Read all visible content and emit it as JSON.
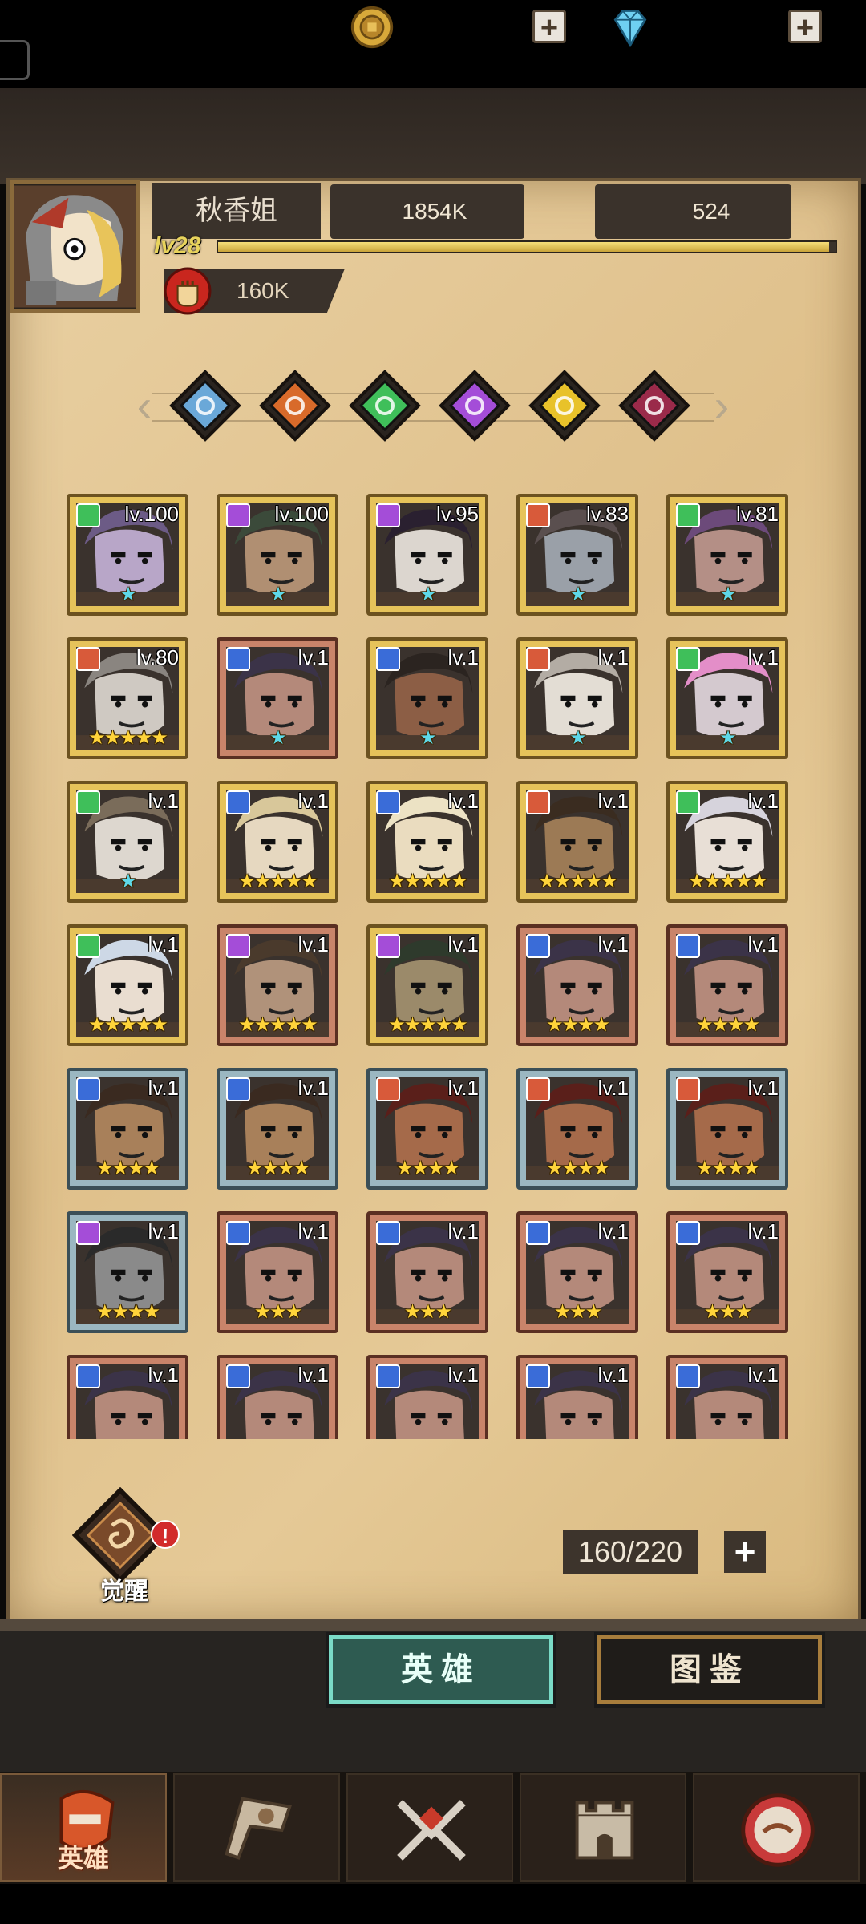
{
  "player": {
    "name": "秋香姐",
    "level": "lv28",
    "xp_fraction": 0.99,
    "power": "160K"
  },
  "resources": {
    "gold": "1854K",
    "gems": "524",
    "plus": "+"
  },
  "filters": [
    {
      "name": "all-class-filter",
      "color": "#6aa8d8"
    },
    {
      "name": "fire-class-filter",
      "color": "#d86a2a"
    },
    {
      "name": "nature-class-filter",
      "color": "#3fbf5a"
    },
    {
      "name": "arcane-class-filter",
      "color": "#a44dd8"
    },
    {
      "name": "light-class-filter",
      "color": "#e8c22a"
    },
    {
      "name": "dark-class-filter",
      "color": "#9a2a4a"
    }
  ],
  "heroes": [
    {
      "level": "lv.100",
      "frame": "gold",
      "cls": "#3fbf5a",
      "stars": "★",
      "star_color": "blue",
      "skin": "#b8a6c8",
      "hair": "#6c5b86"
    },
    {
      "level": "lv.100",
      "frame": "gold",
      "cls": "#a44dd8",
      "stars": "★",
      "star_color": "blue",
      "skin": "#b08f72",
      "hair": "#3b4a3a"
    },
    {
      "level": "lv.95",
      "frame": "gold",
      "cls": "#a44dd8",
      "stars": "★",
      "star_color": "blue",
      "skin": "#dcd6cf",
      "hair": "#2a2030"
    },
    {
      "level": "lv.83",
      "frame": "gold",
      "cls": "#d85a3a",
      "stars": "★",
      "star_color": "blue",
      "skin": "#9aa0a8",
      "hair": "#5a4f4f"
    },
    {
      "level": "lv.81",
      "frame": "gold",
      "cls": "#3fbf5a",
      "stars": "★",
      "star_color": "blue",
      "skin": "#b48f86",
      "hair": "#6c4a7a"
    },
    {
      "level": "lv.80",
      "frame": "gold",
      "cls": "#d85a3a",
      "stars": "★★★★★",
      "star_color": "gold",
      "skin": "#cfc9c2",
      "hair": "#8a8580"
    },
    {
      "level": "lv.1",
      "frame": "bronze",
      "cls": "#3a6cd8",
      "stars": "★",
      "star_color": "blue",
      "skin": "#b4897a",
      "hair": "#3b3348"
    },
    {
      "level": "lv.1",
      "frame": "gold",
      "cls": "#3a6cd8",
      "stars": "★",
      "star_color": "blue",
      "skin": "#8c5e45",
      "hair": "#2b2420"
    },
    {
      "level": "lv.1",
      "frame": "gold",
      "cls": "#d85a3a",
      "stars": "★",
      "star_color": "blue",
      "skin": "#e3ddd4",
      "hair": "#b3aca4"
    },
    {
      "level": "lv.1",
      "frame": "gold",
      "cls": "#3fbf5a",
      "stars": "★",
      "star_color": "blue",
      "skin": "#d4c9cf",
      "hair": "#e38ec8"
    },
    {
      "level": "lv.1",
      "frame": "gold",
      "cls": "#3fbf5a",
      "stars": "★",
      "star_color": "blue",
      "skin": "#ddd7cf",
      "hair": "#7a6c5a"
    },
    {
      "level": "lv.1",
      "frame": "gold",
      "cls": "#3a6cd8",
      "stars": "★★★★★",
      "star_color": "gold",
      "skin": "#e6d8c0",
      "hair": "#d8c79a"
    },
    {
      "level": "lv.1",
      "frame": "gold",
      "cls": "#3a6cd8",
      "stars": "★★★★★",
      "star_color": "gold",
      "skin": "#eadcbf",
      "hair": "#ece2c4"
    },
    {
      "level": "lv.1",
      "frame": "gold",
      "cls": "#d85a3a",
      "stars": "★★★★★",
      "star_color": "gold",
      "skin": "#9c7a55",
      "hair": "#3a2c20"
    },
    {
      "level": "lv.1",
      "frame": "gold",
      "cls": "#3fbf5a",
      "stars": "★★★★★",
      "star_color": "gold",
      "skin": "#e8dfd6",
      "hair": "#d6d3dc"
    },
    {
      "level": "lv.1",
      "frame": "gold",
      "cls": "#3fbf5a",
      "stars": "★★★★★",
      "star_color": "gold",
      "skin": "#e9ddd0",
      "hair": "#cdd8e6"
    },
    {
      "level": "lv.1",
      "frame": "bronze",
      "cls": "#a44dd8",
      "stars": "★★★★★",
      "star_color": "gold",
      "skin": "#b0927a",
      "hair": "#4a3a2c"
    },
    {
      "level": "lv.1",
      "frame": "gold",
      "cls": "#a44dd8",
      "stars": "★★★★★",
      "star_color": "gold",
      "skin": "#9b8a6a",
      "hair": "#2e3a2c"
    },
    {
      "level": "lv.1",
      "frame": "bronze",
      "cls": "#3a6cd8",
      "stars": "★★★★",
      "star_color": "gold",
      "skin": "#b4897a",
      "hair": "#3b3348"
    },
    {
      "level": "lv.1",
      "frame": "bronze",
      "cls": "#3a6cd8",
      "stars": "★★★★",
      "star_color": "gold",
      "skin": "#b4897a",
      "hair": "#3b3348"
    },
    {
      "level": "lv.1",
      "frame": "silver",
      "cls": "#3a6cd8",
      "stars": "★★★★",
      "star_color": "gold",
      "skin": "#a8805a",
      "hair": "#3a2a20"
    },
    {
      "level": "lv.1",
      "frame": "silver",
      "cls": "#3a6cd8",
      "stars": "★★★★",
      "star_color": "gold",
      "skin": "#a8805a",
      "hair": "#3a2a20"
    },
    {
      "level": "lv.1",
      "frame": "silver",
      "cls": "#d85a3a",
      "stars": "★★★★",
      "star_color": "gold",
      "skin": "#a56a4a",
      "hair": "#5a1f1a"
    },
    {
      "level": "lv.1",
      "frame": "silver",
      "cls": "#d85a3a",
      "stars": "★★★★",
      "star_color": "gold",
      "skin": "#a56a4a",
      "hair": "#5a1f1a"
    },
    {
      "level": "lv.1",
      "frame": "silver",
      "cls": "#d85a3a",
      "stars": "★★★★",
      "star_color": "gold",
      "skin": "#a56a4a",
      "hair": "#5a1f1a"
    },
    {
      "level": "lv.1",
      "frame": "silver",
      "cls": "#a44dd8",
      "stars": "★★★★",
      "star_color": "gold",
      "skin": "#8a8a8a",
      "hair": "#2a2a2a"
    },
    {
      "level": "lv.1",
      "frame": "bronze",
      "cls": "#3a6cd8",
      "stars": "★★★",
      "star_color": "gold",
      "skin": "#b4897a",
      "hair": "#3b3348"
    },
    {
      "level": "lv.1",
      "frame": "bronze",
      "cls": "#3a6cd8",
      "stars": "★★★",
      "star_color": "gold",
      "skin": "#b4897a",
      "hair": "#3b3348"
    },
    {
      "level": "lv.1",
      "frame": "bronze",
      "cls": "#3a6cd8",
      "stars": "★★★",
      "star_color": "gold",
      "skin": "#b4897a",
      "hair": "#3b3348"
    },
    {
      "level": "lv.1",
      "frame": "bronze",
      "cls": "#3a6cd8",
      "stars": "★★★",
      "star_color": "gold",
      "skin": "#b4897a",
      "hair": "#3b3348"
    },
    {
      "level": "lv.1",
      "frame": "bronze",
      "cls": "#3a6cd8",
      "stars": "",
      "star_color": "gold",
      "skin": "#b4897a",
      "hair": "#3b3348"
    },
    {
      "level": "lv.1",
      "frame": "bronze",
      "cls": "#3a6cd8",
      "stars": "",
      "star_color": "gold",
      "skin": "#b4897a",
      "hair": "#3b3348"
    },
    {
      "level": "lv.1",
      "frame": "bronze",
      "cls": "#3a6cd8",
      "stars": "",
      "star_color": "gold",
      "skin": "#b4897a",
      "hair": "#3b3348"
    },
    {
      "level": "lv.1",
      "frame": "bronze",
      "cls": "#3a6cd8",
      "stars": "",
      "star_color": "gold",
      "skin": "#b4897a",
      "hair": "#3b3348"
    },
    {
      "level": "lv.1",
      "frame": "bronze",
      "cls": "#3a6cd8",
      "stars": "",
      "star_color": "gold",
      "skin": "#b4897a",
      "hair": "#3b3348"
    }
  ],
  "awaken": {
    "label": "觉醒",
    "badge": "!"
  },
  "capacity": {
    "value": "160/220",
    "plus": "+"
  },
  "tabs": {
    "heroes": "英雄",
    "atlas": "图鉴"
  },
  "nav": [
    {
      "name": "nav-heroes",
      "label": "英雄",
      "active": true
    },
    {
      "name": "nav-adventure",
      "label": "",
      "active": false
    },
    {
      "name": "nav-battle",
      "label": "",
      "active": false
    },
    {
      "name": "nav-castle",
      "label": "",
      "active": false
    },
    {
      "name": "nav-guild",
      "label": "",
      "active": false
    }
  ]
}
